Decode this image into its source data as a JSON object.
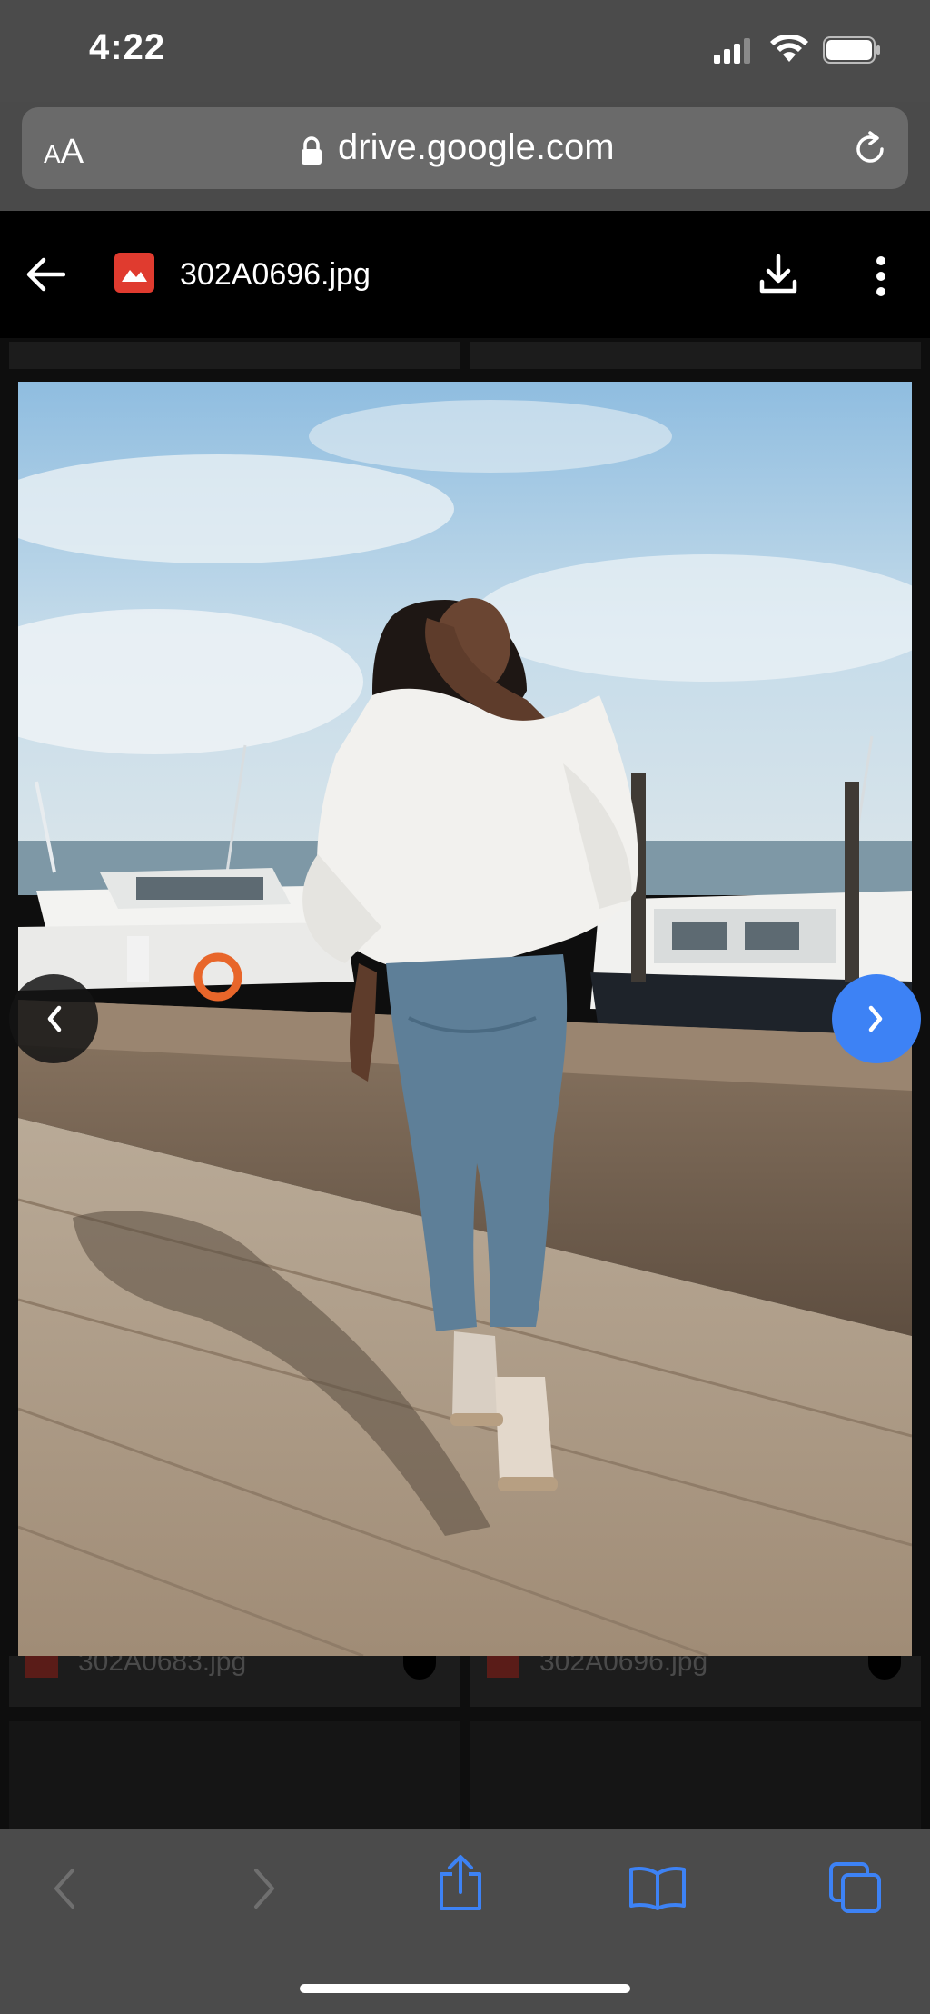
{
  "status_bar": {
    "time": "4:22"
  },
  "browser": {
    "text_size_small": "A",
    "text_size_large": "A",
    "url": "drive.google.com"
  },
  "viewer": {
    "file_name": "302A0696.jpg"
  },
  "gallery": {
    "items": [
      {
        "name": "302A0683.jpg"
      },
      {
        "name": "302A0696.jpg"
      }
    ]
  },
  "colors": {
    "accent_blue": "#3d82f5",
    "file_icon_red": "#e03b2f",
    "toolbar_gray": "#4b4b4b"
  },
  "icons": [
    "back-arrow-icon",
    "image-file-icon",
    "download-icon",
    "more-vert-icon",
    "lock-icon",
    "reload-icon",
    "chevron-left-icon",
    "chevron-right-icon",
    "safari-back-icon",
    "safari-forward-icon",
    "share-icon",
    "bookmarks-icon",
    "tabs-icon"
  ]
}
